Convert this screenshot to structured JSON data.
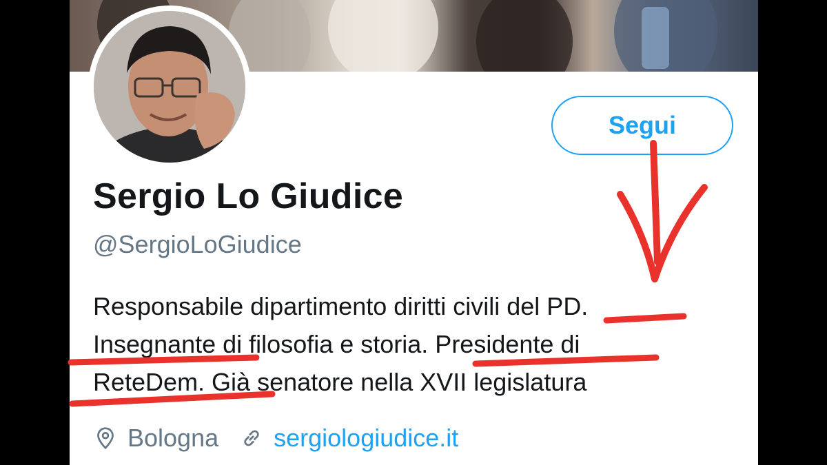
{
  "profile": {
    "display_name": "Sergio Lo Giudice",
    "handle": "@SergioLoGiudice",
    "follow_label": "Segui",
    "bio_lines": [
      "Responsabile dipartimento diritti civili  del PD.",
      "Insegnante di filosofia e storia. Presidente di",
      "ReteDem. Già senatore nella XVII legislatura"
    ],
    "location": "Bologna",
    "website": "sergiologiudice.it",
    "icons": {
      "location": "location-pin-icon",
      "link": "link-icon"
    }
  },
  "colors": {
    "accent": "#1da1f2",
    "text_primary": "#14171a",
    "text_secondary": "#657786",
    "annotation": "#e8322b"
  }
}
